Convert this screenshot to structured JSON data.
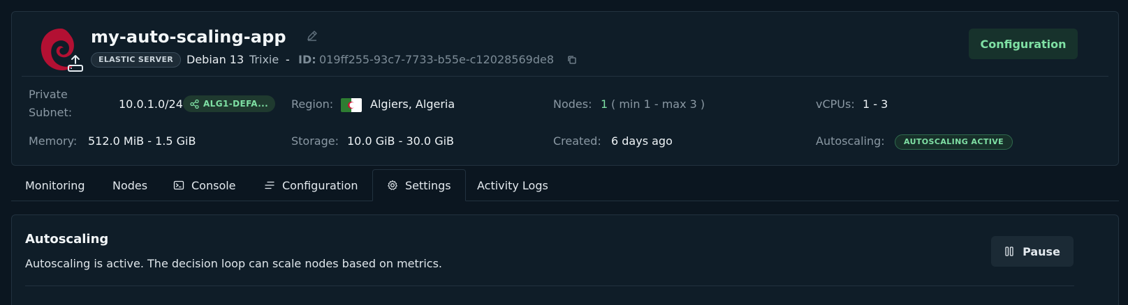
{
  "header": {
    "app_name": "my-auto-scaling-app",
    "type_badge": "ELASTIC SERVER",
    "os_name": "Debian 13",
    "os_codename": "Trixie",
    "separator": "-",
    "id_label": "ID:",
    "id_value": "019ff255-93c7-7733-b55e-c12028569de8",
    "config_button": "Configuration",
    "logo_icon": "debian-swirl-icon",
    "accent_color": "#7fe0a4"
  },
  "details": {
    "private_subnet_label_line1": "Private",
    "private_subnet_label_line2": "Subnet:",
    "private_subnet_value": "10.0.1.0/24",
    "subnet_badge": "ALG1-DEFA...",
    "region_label": "Region:",
    "region_value": "Algiers, Algeria",
    "nodes_label": "Nodes:",
    "nodes_value": "1",
    "nodes_range": "( min 1 - max 3 )",
    "vcpus_label": "vCPUs:",
    "vcpus_value": "1 - 3",
    "memory_label": "Memory:",
    "memory_value": "512.0 MiB - 1.5 GiB",
    "storage_label": "Storage:",
    "storage_value": "10.0 GiB - 30.0 GiB",
    "created_label": "Created:",
    "created_value": "6 days ago",
    "autoscaling_label": "Autoscaling:",
    "autoscaling_badge": "AUTOSCALING ACTIVE"
  },
  "tabs": [
    {
      "label": "Monitoring"
    },
    {
      "label": "Nodes"
    },
    {
      "label": "Console"
    },
    {
      "label": "Configuration"
    },
    {
      "label": "Settings"
    },
    {
      "label": "Activity Logs"
    }
  ],
  "settings": {
    "title": "Autoscaling",
    "description": "Autoscaling is active. The decision loop can scale nodes based on metrics.",
    "pause_button": "Pause"
  }
}
